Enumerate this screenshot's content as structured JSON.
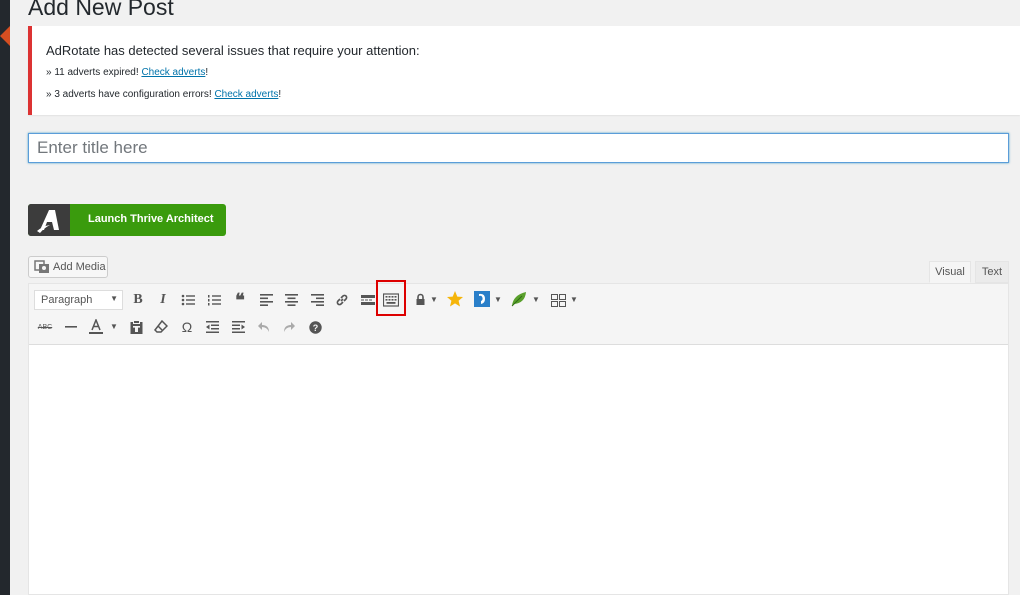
{
  "page": {
    "title": "Add New Post"
  },
  "notice": {
    "title": "AdRotate has detected several issues that require your attention:",
    "line1_prefix": "» 11 adverts expired!",
    "line1_link": "Check adverts",
    "line1_suffix": "!",
    "line2_prefix": "» 3 adverts have configuration errors!",
    "line2_link": "Check adverts",
    "line2_suffix": "!"
  },
  "title_field": {
    "placeholder": "Enter title here",
    "value": ""
  },
  "thrive": {
    "label": "Launch Thrive Architect"
  },
  "media": {
    "label": "Add Media"
  },
  "tabs": {
    "visual": "Visual",
    "text": "Text"
  },
  "toolbar": {
    "format_select": "Paragraph",
    "bold": "B",
    "italic": "I",
    "blockquote": "❝",
    "special_chars": "Ω",
    "help": "?",
    "strikethrough": "ABC"
  },
  "colors": {
    "accent": "#0073aa",
    "error": "#dc3232",
    "thrive_green": "#3a9b0d",
    "highlight": "#d00000"
  }
}
